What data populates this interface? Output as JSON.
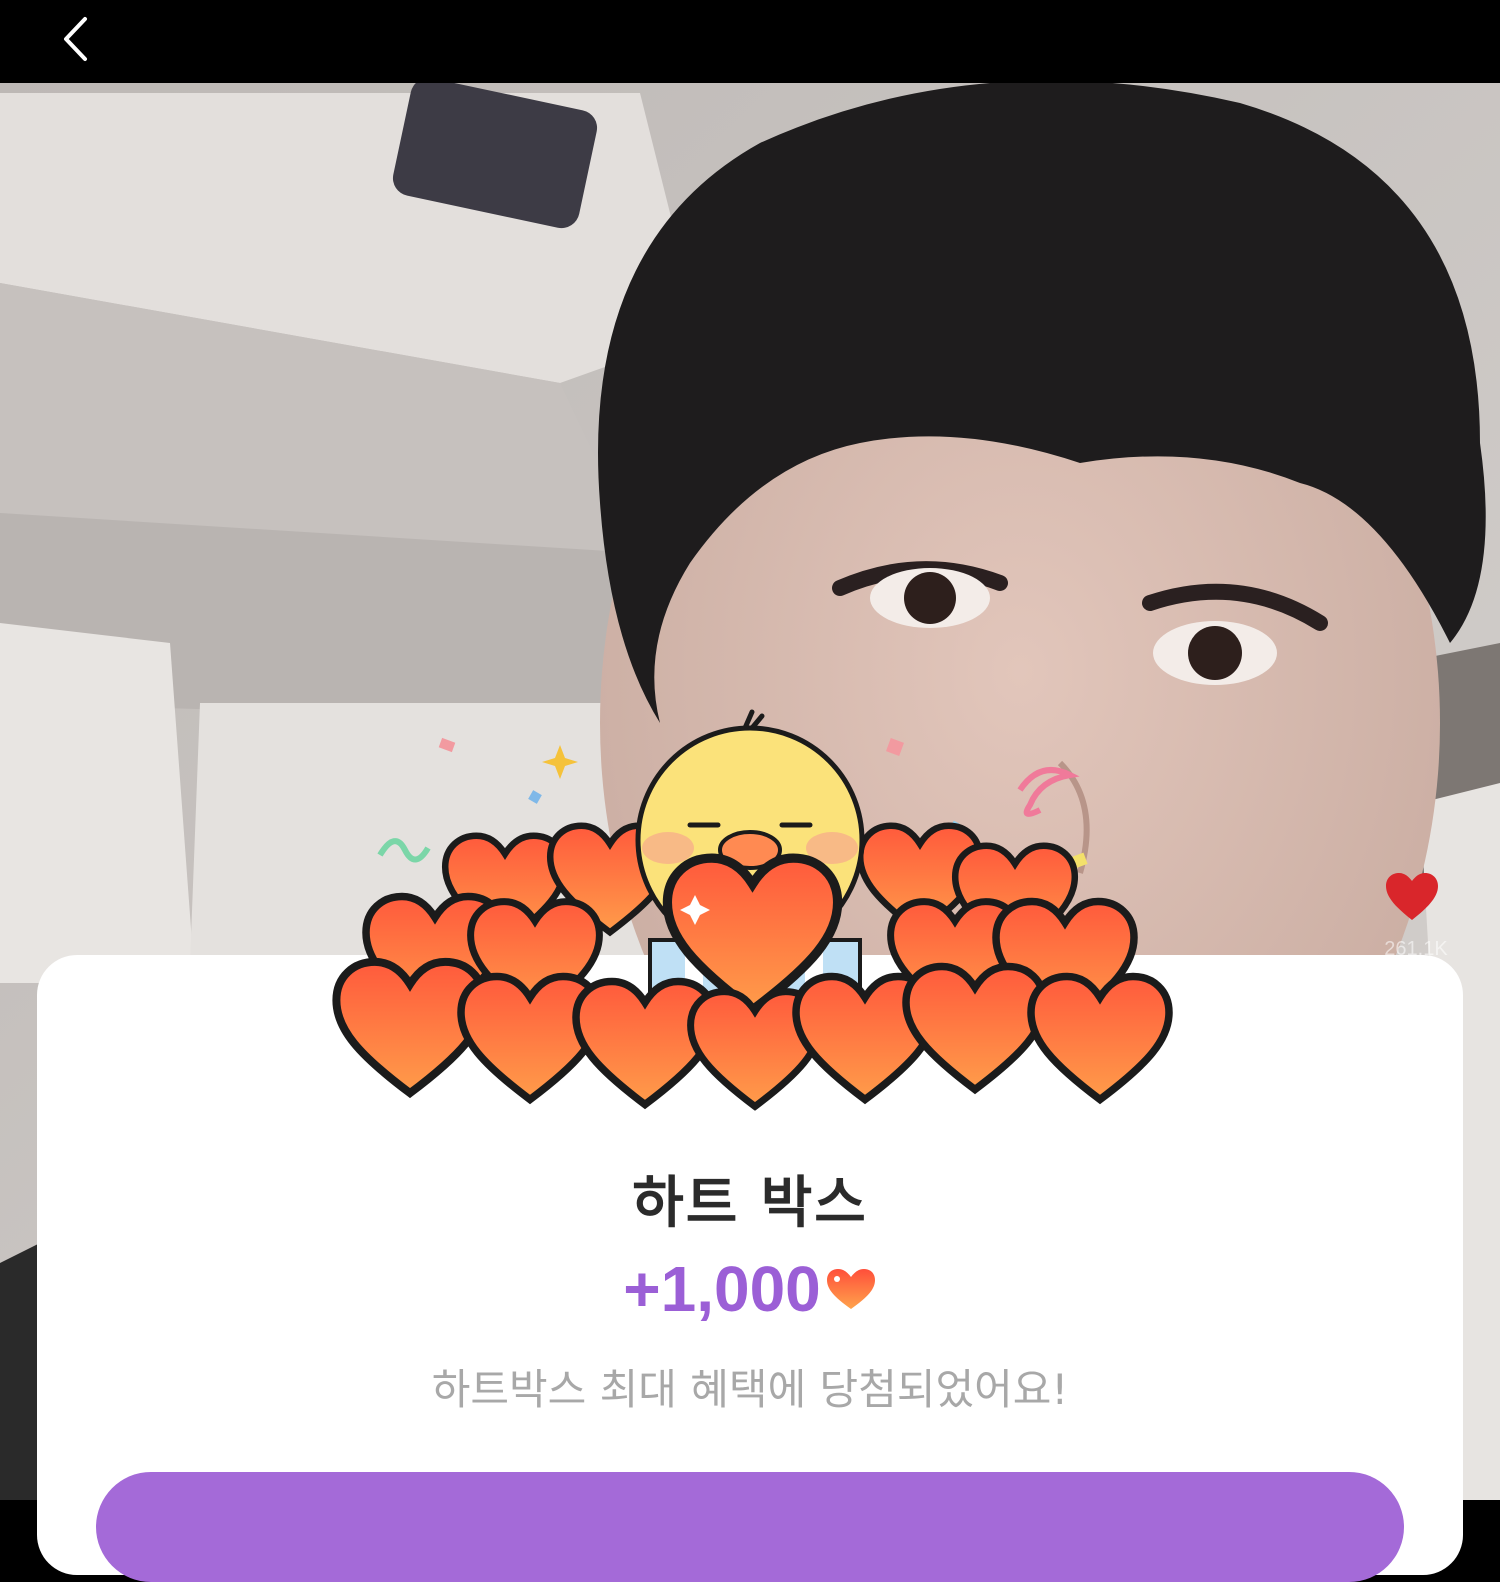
{
  "header": {
    "back_icon": "chevron-left-icon"
  },
  "side_reaction": {
    "icon": "heart-icon",
    "count": "261.1K",
    "color": "#d9262b"
  },
  "popup": {
    "title": "하트 박스",
    "reward_amount": "+1,000",
    "reward_icon": "heart-icon",
    "message": "하트박스 최대 혜택에 당첨되었어요!",
    "accent_color": "#9b5fd6",
    "button_color": "#a46ad8"
  }
}
